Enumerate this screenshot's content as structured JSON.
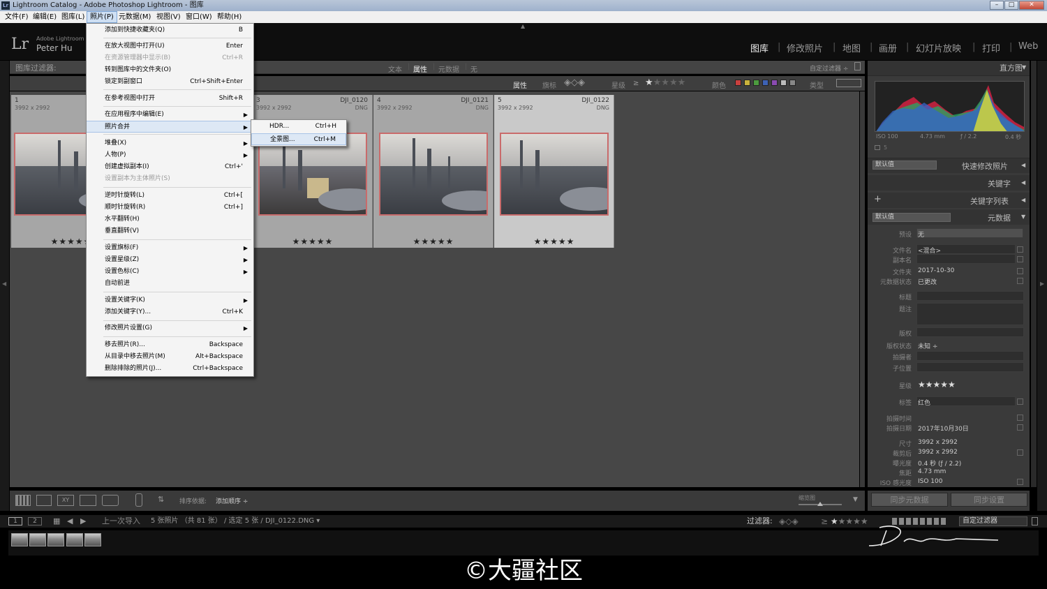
{
  "titlebar": {
    "title": "Lightroom Catalog - Adobe Photoshop Lightroom - 图库",
    "app_icon": "Lr"
  },
  "menubar": {
    "items": [
      "文件(F)",
      "编辑(E)",
      "图库(L)",
      "照片(P)",
      "元数据(M)",
      "视图(V)",
      "窗口(W)",
      "帮助(H)"
    ],
    "active": "照片(P)"
  },
  "identity": {
    "logo": "Lr",
    "small": "Adobe Lightroom C",
    "name": "Peter Hu"
  },
  "modules": [
    "图库",
    "修改照片",
    "地图",
    "画册",
    "幻灯片放映",
    "打印",
    "Web"
  ],
  "filterbar": {
    "label": "图库过滤器:",
    "tabs": [
      "文本",
      "属性",
      "元数据",
      "无"
    ],
    "active": "属性",
    "custom": "自定过滤器 ÷"
  },
  "attrbar": {
    "attr": "属性",
    "flag": "旗标",
    "rating": "星级",
    "ge": "≥",
    "color": "颜色",
    "kind": "类型",
    "colors": [
      "#c9403e",
      "#c9b23c",
      "#4c9b3f",
      "#3d62b5",
      "#8a4bb0",
      "#bbbbbb",
      "#888888"
    ]
  },
  "photos": [
    {
      "num": "1",
      "dims": "3992 x 2992",
      "name": "",
      "ext": "",
      "stars": "★★★★★"
    },
    {
      "num": "3",
      "dims": "3992 x 2992",
      "name": "DJI_0120",
      "ext": "DNG",
      "stars": "★★★★★"
    },
    {
      "num": "4",
      "dims": "3992 x 2992",
      "name": "DJI_0121",
      "ext": "DNG",
      "stars": "★★★★★"
    },
    {
      "num": "5",
      "dims": "3992 x 2992",
      "name": "DJI_0122",
      "ext": "DNG",
      "stars": "★★★★★"
    }
  ],
  "photo_menu": {
    "items": [
      {
        "label": "添加到快捷收藏夹(Q)",
        "shortcut": "B"
      },
      {
        "label": "在放大视图中打开(U)",
        "shortcut": "Enter"
      },
      {
        "label": "在资源管理器中显示(B)",
        "shortcut": "Ctrl+R",
        "disabled": true
      },
      {
        "label": "转到图库中的文件夹(O)",
        "shortcut": ""
      },
      {
        "label": "锁定到副窗口",
        "shortcut": "Ctrl+Shift+Enter"
      },
      {
        "label": "在参考视图中打开",
        "shortcut": "Shift+R"
      },
      {
        "label": "在应用程序中编辑(E)",
        "shortcut": ""
      },
      {
        "label": "照片合并",
        "shortcut": ""
      },
      {
        "label": "堆叠(X)",
        "shortcut": ""
      },
      {
        "label": "人物(P)",
        "shortcut": ""
      },
      {
        "label": "创建虚拟副本(I)",
        "shortcut": "Ctrl+'"
      },
      {
        "label": "设置副本为主体照片(S)",
        "shortcut": "",
        "disabled": true
      },
      {
        "label": "逆时针旋转(L)",
        "shortcut": "Ctrl+["
      },
      {
        "label": "顺时针旋转(R)",
        "shortcut": "Ctrl+]"
      },
      {
        "label": "水平翻转(H)",
        "shortcut": ""
      },
      {
        "label": "垂直翻转(V)",
        "shortcut": ""
      },
      {
        "label": "设置旗标(F)",
        "shortcut": ""
      },
      {
        "label": "设置星级(Z)",
        "shortcut": ""
      },
      {
        "label": "设置色标(C)",
        "shortcut": ""
      },
      {
        "label": "自动前进",
        "shortcut": ""
      },
      {
        "label": "设置关键字(K)",
        "shortcut": ""
      },
      {
        "label": "添加关键字(Y)...",
        "shortcut": "Ctrl+K"
      },
      {
        "label": "修改照片设置(G)",
        "shortcut": ""
      },
      {
        "label": "移去照片(R)...",
        "shortcut": "Backspace"
      },
      {
        "label": "从目录中移去照片(M)",
        "shortcut": "Alt+Backspace"
      },
      {
        "label": "删除排除的照片(J)...",
        "shortcut": "Ctrl+Backspace"
      }
    ]
  },
  "merge_submenu": [
    {
      "label": "HDR...",
      "shortcut": "Ctrl+H"
    },
    {
      "label": "全景图...",
      "shortcut": "Ctrl+M"
    }
  ],
  "bottombar": {
    "sort_label": "排序依据:",
    "sort_value": "添加顺序 ÷",
    "thumb_label": "缩览图"
  },
  "right_panel": {
    "histogram": "直方图",
    "info": {
      "iso": "ISO 100",
      "focal": "4.73 mm",
      "aperture": "ƒ / 2.2",
      "shutter": "0.4 秒",
      "count": "5"
    },
    "quick_develop_preset": "默认值",
    "quick_develop": "快速修改照片",
    "keywords": "关键字",
    "keyword_list": "关键字列表",
    "metadata_preset": "默认值",
    "metadata": "元数据",
    "fields": {
      "preset_label": "预设",
      "preset_value": "无",
      "filename_label": "文件名",
      "filename_value": "<混合>",
      "copyname_label": "副本名",
      "folder_label": "文件夹",
      "folder_value": "2017-10-30",
      "status_label": "元数据状态",
      "status_value": "已更改",
      "title_label": "标题",
      "caption_label": "题注",
      "copyright_label": "版权",
      "copyright_status_label": "版权状态",
      "copyright_status_value": "未知 ÷",
      "creator_label": "拍摄者",
      "sublocation_label": "子位置",
      "rating_label": "星级",
      "rating_value": "★★★★★",
      "label_label": "标签",
      "label_value": "红色",
      "capture_time_label": "拍摄时间",
      "capture_date_label": "拍摄日期",
      "capture_date_value": "2017年10月30日",
      "dims_label": "尺寸",
      "dims_value": "3992 x 2992",
      "cropped_label": "裁剪后",
      "cropped_value": "3992 x 2992",
      "exposure_label": "曝光度",
      "exposure_value": "0.4 秒 (ƒ / 2.2)",
      "focal_label": "焦距",
      "focal_value": "4.73 mm",
      "iso_label": "ISO 感光度",
      "iso_value": "ISO 100"
    },
    "sync_metadata": "同步元数据",
    "sync_settings": "同步设置"
  },
  "filmstrip_bar": {
    "page1": "1",
    "page2": "2",
    "source": "上一次导入",
    "summary": "5 张照片 （共 81 张） / 选定 5 张 / DJI_0122.DNG ▾",
    "filter_label": "过滤器:",
    "custom": "自定过滤器"
  },
  "watermark": "©大疆社区"
}
